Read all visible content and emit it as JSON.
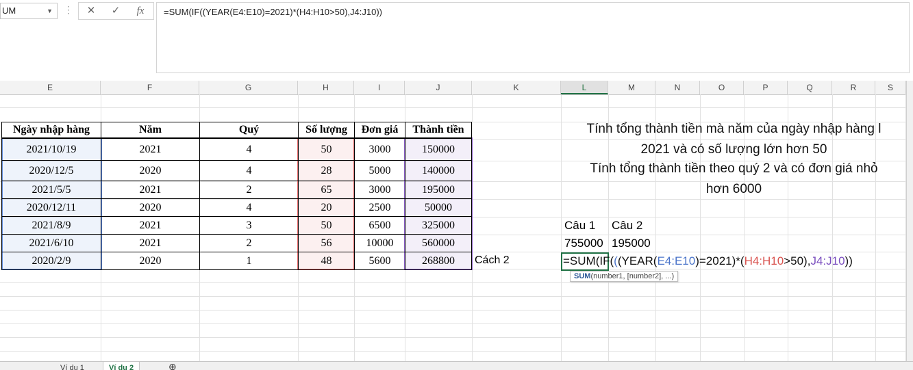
{
  "formula_bar": {
    "name_box": "UM",
    "cancel_icon": "✕",
    "enter_icon": "✓",
    "fx_icon": "fx",
    "formula": "=SUM(IF((YEAR(E4:E10)=2021)*(H4:H10>50),J4:J10))"
  },
  "columns": [
    "E",
    "F",
    "G",
    "H",
    "I",
    "J",
    "K",
    "L",
    "M",
    "N",
    "O",
    "P",
    "Q",
    "R",
    "S"
  ],
  "table": {
    "headers": [
      "Ngày nhập hàng",
      "Năm",
      "Quý",
      "Số lượng",
      "Đơn giá",
      "Thành tiền"
    ],
    "rows": [
      [
        "2021/10/19",
        "2021",
        "4",
        "50",
        "3000",
        "150000"
      ],
      [
        "2020/12/5",
        "2020",
        "4",
        "28",
        "5000",
        "140000"
      ],
      [
        "2021/5/5",
        "2021",
        "2",
        "65",
        "3000",
        "195000"
      ],
      [
        "2020/12/11",
        "2020",
        "4",
        "20",
        "2500",
        "50000"
      ],
      [
        "2021/8/9",
        "2021",
        "3",
        "50",
        "6500",
        "325000"
      ],
      [
        "2021/6/10",
        "2021",
        "2",
        "56",
        "10000",
        "560000"
      ],
      [
        "2020/2/9",
        "2020",
        "1",
        "48",
        "5600",
        "268800"
      ]
    ]
  },
  "questions": {
    "q1_line1": "Tính tổng thành tiền mà năm của ngày nhập hàng l",
    "q1_line2": "2021 và có số lượng lớn hơn 50",
    "q2_line1": "Tính tổng thành tiền theo quý 2 và có đơn giá nhỏ",
    "q2_line2": "hơn 6000"
  },
  "answers": {
    "cau1_label": "Câu 1",
    "cau2_label": "Câu 2",
    "cau1_value": "755000",
    "cau2_value": "195000",
    "cach2_label": "Cách 2"
  },
  "edit": {
    "p1": "=SUM(IF(",
    "p2": "(",
    "p3": "(YEAR(",
    "p4": "E4:E10",
    "p5": ")=2021)*(",
    "p6": "H4:H10",
    "p7": ">50),",
    "p8": "J4:J10",
    "p9": "))",
    "tooltip_fn": "SUM",
    "tooltip_args": "(number1, [number2], ...)"
  },
  "tabs": [
    "Ví dụ 1",
    "Ví dụ 2"
  ],
  "colors": {
    "blue": "#4a74c9",
    "red": "#d9534f",
    "purple": "#7b4fbf",
    "green": "#217346"
  }
}
